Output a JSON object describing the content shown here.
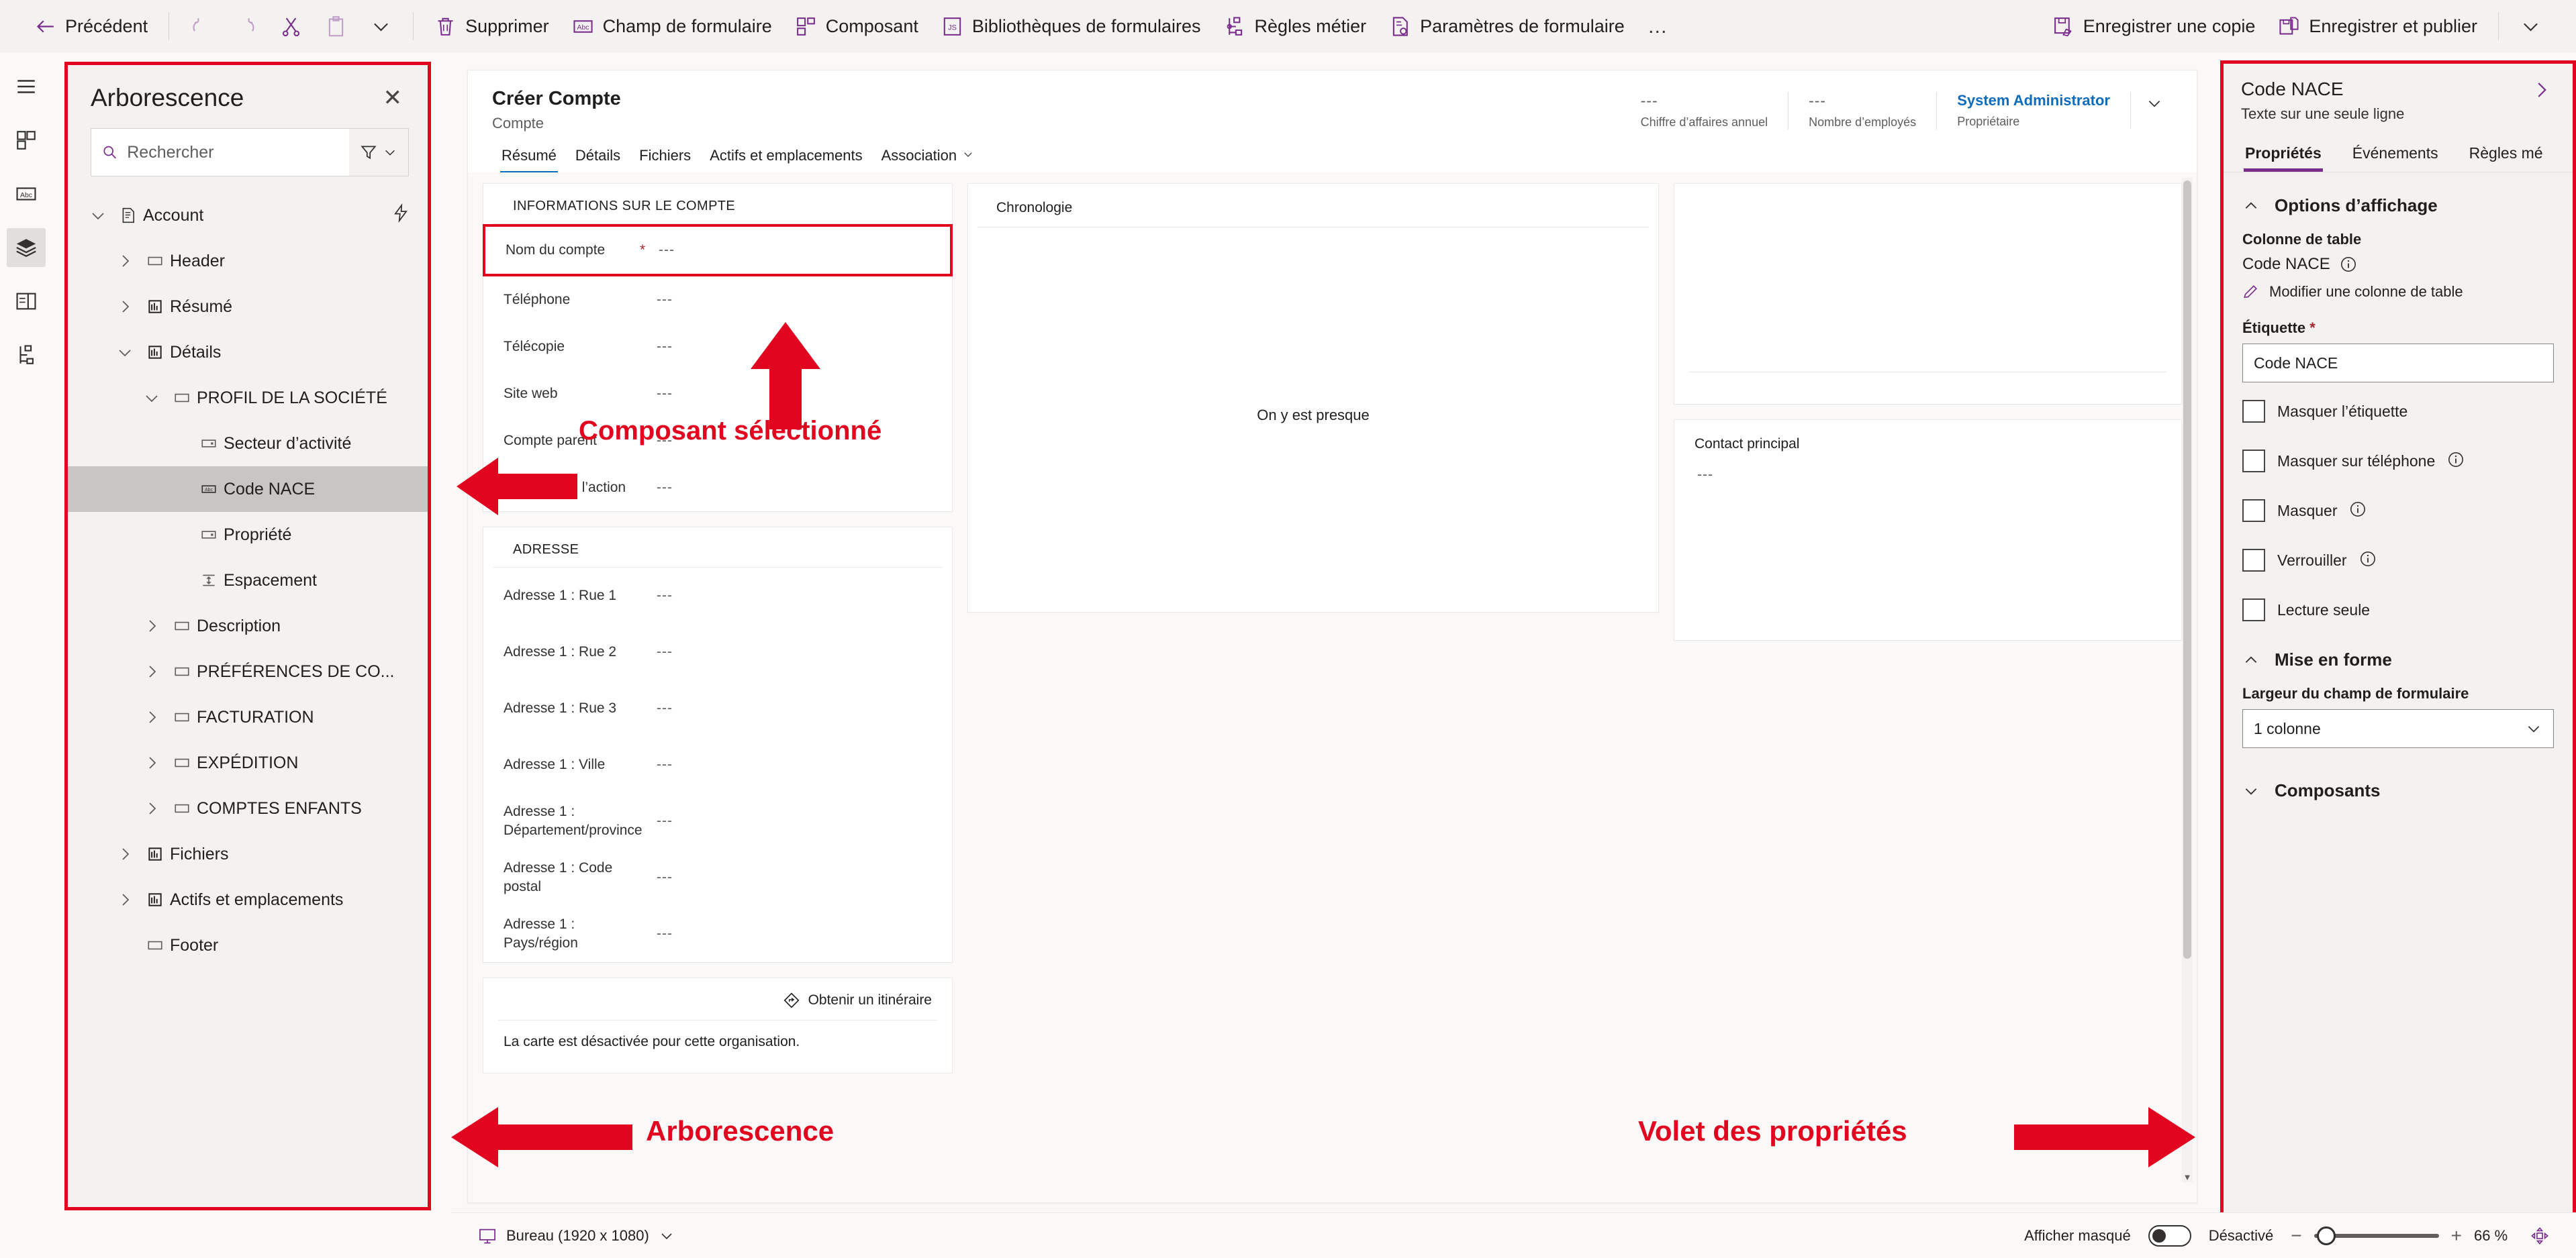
{
  "commandbar": {
    "back_label": "Précédent",
    "undo_label": "Annuler",
    "redo_label": "Rétablir",
    "cut_label": "Couper",
    "paste_label": "Coller",
    "more_caret_label": "",
    "delete_label": "Supprimer",
    "form_field_label": "Champ de formulaire",
    "component_label": "Composant",
    "form_libraries_label": "Bibliothèques de formulaires",
    "business_rules_label": "Règles métier",
    "form_settings_label": "Paramètres de formulaire",
    "overflow_label": "…",
    "save_copy_label": "Enregistrer une copie",
    "save_publish_label": "Enregistrer et publier"
  },
  "tree": {
    "title": "Arborescence",
    "close_label": "✕",
    "search_placeholder": "Rechercher",
    "search_value": "",
    "nodes": [
      {
        "label": "Account",
        "depth": 0,
        "chev": "down",
        "icon": "form-icon",
        "flash": true,
        "selected": false
      },
      {
        "label": "Header",
        "depth": 1,
        "chev": "right",
        "icon": "section-icon",
        "flash": false,
        "selected": false
      },
      {
        "label": "Résumé",
        "depth": 1,
        "chev": "right",
        "icon": "tab-icon",
        "flash": false,
        "selected": false
      },
      {
        "label": "Détails",
        "depth": 1,
        "chev": "down",
        "icon": "tab-icon",
        "flash": false,
        "selected": false
      },
      {
        "label": "PROFIL DE LA SOCIÉTÉ",
        "depth": 2,
        "chev": "down",
        "icon": "section-icon",
        "flash": false,
        "selected": false
      },
      {
        "label": "Secteur d’activité",
        "depth": 3,
        "chev": "none",
        "icon": "choice-icon",
        "flash": false,
        "selected": false
      },
      {
        "label": "Code NACE",
        "depth": 3,
        "chev": "none",
        "icon": "text-icon",
        "flash": false,
        "selected": true
      },
      {
        "label": "Propriété",
        "depth": 3,
        "chev": "none",
        "icon": "choice-icon",
        "flash": false,
        "selected": false
      },
      {
        "label": "Espacement",
        "depth": 3,
        "chev": "none",
        "icon": "spacer-icon",
        "flash": false,
        "selected": false
      },
      {
        "label": "Description",
        "depth": 2,
        "chev": "right",
        "icon": "section-icon",
        "flash": false,
        "selected": false
      },
      {
        "label": "PRÉFÉRENCES DE CO...",
        "depth": 2,
        "chev": "right",
        "icon": "section-icon",
        "flash": false,
        "selected": false
      },
      {
        "label": "FACTURATION",
        "depth": 2,
        "chev": "right",
        "icon": "section-icon",
        "flash": false,
        "selected": false
      },
      {
        "label": "EXPÉDITION",
        "depth": 2,
        "chev": "right",
        "icon": "section-icon",
        "flash": false,
        "selected": false
      },
      {
        "label": "COMPTES ENFANTS",
        "depth": 2,
        "chev": "right",
        "icon": "section-icon",
        "flash": false,
        "selected": false
      },
      {
        "label": "Fichiers",
        "depth": 1,
        "chev": "right",
        "icon": "tab-icon",
        "flash": false,
        "selected": false
      },
      {
        "label": "Actifs et emplacements",
        "depth": 1,
        "chev": "right",
        "icon": "tab-icon",
        "flash": false,
        "selected": false
      },
      {
        "label": "Footer",
        "depth": 1,
        "chev": "none",
        "icon": "section-icon",
        "flash": false,
        "selected": false
      }
    ]
  },
  "form": {
    "title": "Créer Compte",
    "subtitle": "Compte",
    "header_stats": [
      {
        "value": "---",
        "label": "Chiffre d’affaires annuel"
      },
      {
        "value": "---",
        "label": "Nombre d’employés"
      }
    ],
    "owner_value": "System Administrator",
    "owner_label": "Propriétaire",
    "tabs": [
      {
        "label": "Résumé",
        "active": true,
        "caret": false
      },
      {
        "label": "Détails",
        "active": false,
        "caret": false
      },
      {
        "label": "Fichiers",
        "active": false,
        "caret": false
      },
      {
        "label": "Actifs et emplacements",
        "active": false,
        "caret": false
      },
      {
        "label": "Association",
        "active": false,
        "caret": true
      }
    ],
    "account_section": {
      "title": "INFORMATIONS SUR LE COMPTE",
      "fields": [
        {
          "label": "Nom du compte",
          "required": true,
          "value": "---",
          "selected": true
        },
        {
          "label": "Téléphone",
          "required": false,
          "value": "---",
          "selected": false
        },
        {
          "label": "Télécopie",
          "required": false,
          "value": "---",
          "selected": false
        },
        {
          "label": "Site web",
          "required": false,
          "value": "---",
          "selected": false
        },
        {
          "label": "Compte parent",
          "required": false,
          "value": "---",
          "selected": false
        },
        {
          "label": "Symbole de l’action",
          "required": false,
          "value": "---",
          "selected": false
        }
      ]
    },
    "address_section": {
      "title": "ADRESSE",
      "fields": [
        {
          "label": "Adresse 1 : Rue 1",
          "value": "---"
        },
        {
          "label": "Adresse 1 : Rue 2",
          "value": "---"
        },
        {
          "label": "Adresse 1 : Rue 3",
          "value": "---"
        },
        {
          "label": "Adresse 1 : Ville",
          "value": "---"
        },
        {
          "label": "Adresse 1 : Département/province",
          "value": "---"
        },
        {
          "label": "Adresse 1 : Code postal",
          "value": "---"
        },
        {
          "label": "Adresse 1 : Pays/région",
          "value": "---"
        }
      ]
    },
    "map_section": {
      "directions_label": "Obtenir un itinéraire",
      "note": "La carte est désactivée pour cette organisation."
    },
    "timeline": {
      "title": "Chronologie",
      "empty_text": "On y est presque"
    },
    "contact_card": {
      "title": "Contact principal",
      "value": "---"
    }
  },
  "properties": {
    "title": "Code NACE",
    "subtitle": "Texte sur une seule ligne",
    "expand_label": "›",
    "tabs": [
      {
        "label": "Propriétés",
        "active": true
      },
      {
        "label": "Événements",
        "active": false
      },
      {
        "label": "Règles mé",
        "active": false
      }
    ],
    "display_options": {
      "section_label": "Options d’affichage",
      "table_column_label": "Colonne de table",
      "table_column_value": "Code NACE",
      "edit_column_link": "Modifier une colonne de table",
      "label_field_label": "Étiquette",
      "label_field_required": "*",
      "label_field_value": "Code NACE",
      "checkboxes": [
        {
          "label": "Masquer l’étiquette",
          "checked": false,
          "info": false
        },
        {
          "label": "Masquer sur téléphone",
          "checked": false,
          "info": true
        },
        {
          "label": "Masquer",
          "checked": false,
          "info": true
        },
        {
          "label": "Verrouiller",
          "checked": false,
          "info": true
        },
        {
          "label": "Lecture seule",
          "checked": false,
          "info": false
        }
      ]
    },
    "formatting": {
      "section_label": "Mise en forme",
      "width_label": "Largeur du champ de formulaire",
      "width_value": "1 colonne"
    },
    "components": {
      "section_label": "Composants"
    }
  },
  "statusbar": {
    "device_label": "Bureau (1920 x 1080)",
    "show_hidden_label": "Afficher masqué",
    "toggle_state_label": "Désactivé",
    "zoom_out_label": "−",
    "zoom_in_label": "+",
    "zoom_percent": "66 %"
  },
  "annotations": [
    {
      "text": "Composant sélectionné"
    },
    {
      "text": "Arborescence"
    },
    {
      "text": "Volet des propriétés"
    }
  ],
  "colors": {
    "annotation_red": "#e2051f",
    "brand_purple": "#7b2d8e",
    "link_blue": "#0f6cbd",
    "required_red": "#a4262c"
  }
}
